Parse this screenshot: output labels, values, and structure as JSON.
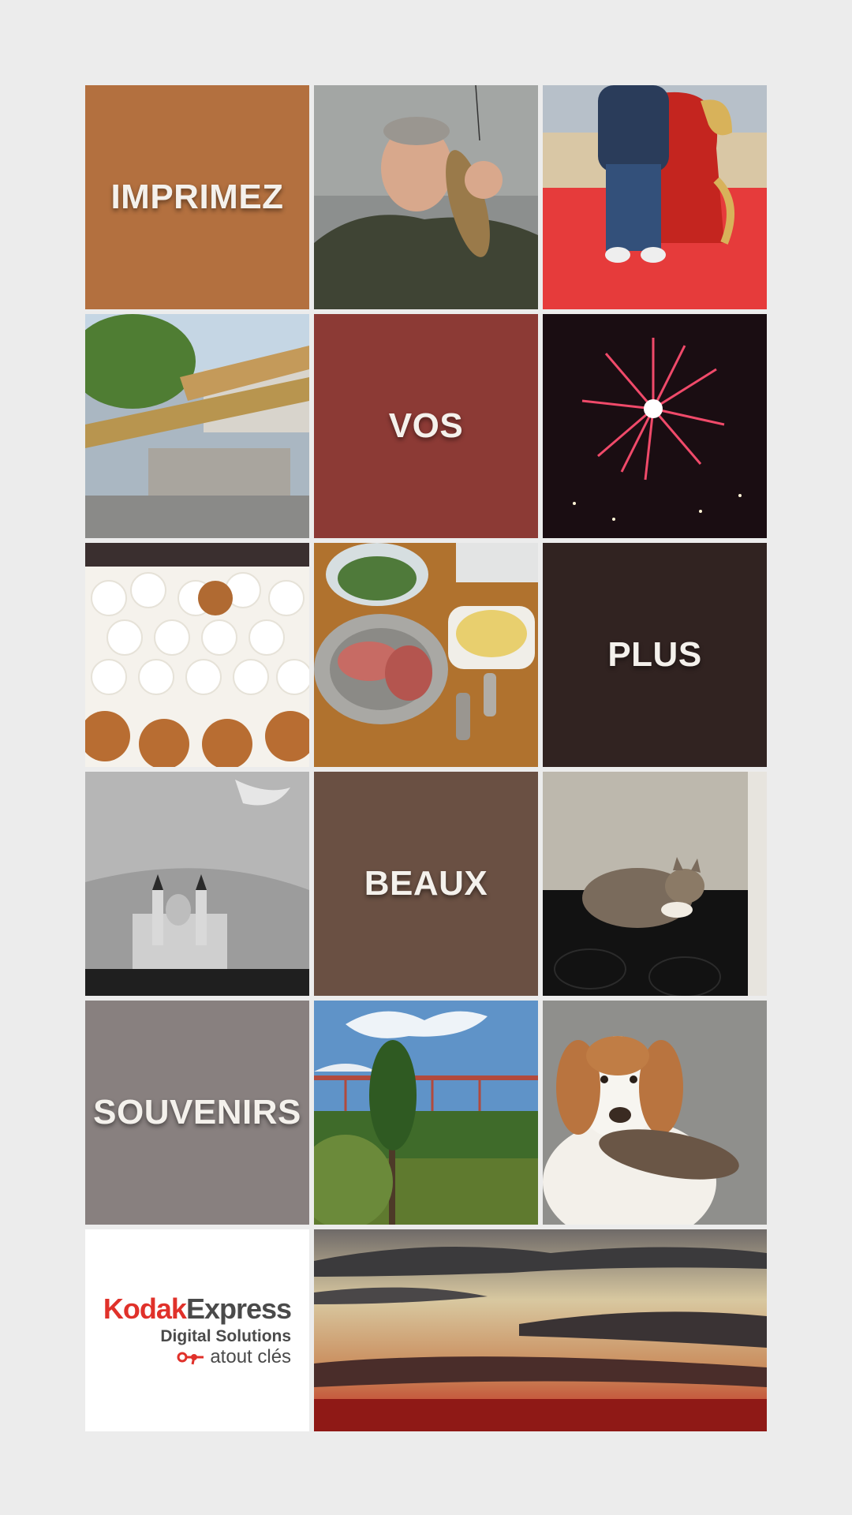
{
  "tiles": {
    "word1": "IMPRIMEZ",
    "word2": "VOS",
    "word3": "PLUS",
    "word4": "BEAUX",
    "word5": "SOUVENIRS"
  },
  "logo": {
    "kodak": "Kodak",
    "express": "Express",
    "subtitle": "Digital Solutions",
    "brand": "atout clés",
    "icon": "key-icon"
  },
  "photos": [
    "man-with-fish",
    "man-on-red-throne",
    "cinder-blocks-construction",
    "fireworks",
    "cream-puff-cake",
    "dinner-table-ham",
    "basilica-black-white",
    "cat-on-stove",
    "viaduct-lake",
    "spaniel-with-bird",
    "sunset-clouds"
  ],
  "colors": {
    "background": "#ececec",
    "imprimez": "#b3703f",
    "vos": "#8c3a35",
    "plus": "#312321",
    "beaux": "#6a5043",
    "souvenirs": "#88807f",
    "kodak_red": "#e0312a"
  }
}
